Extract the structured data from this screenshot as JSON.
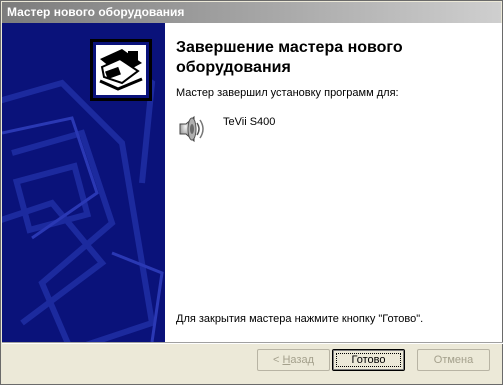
{
  "window": {
    "title": "Мастер нового оборудования"
  },
  "content": {
    "heading": "Завершение мастера нового оборудования",
    "subtext": "Мастер завершил установку программ для:",
    "device": {
      "name": "TeVii S400",
      "icon": "speaker-icon"
    },
    "footer": "Для закрытия мастера нажмите кнопку \"Готово\"."
  },
  "buttons": {
    "back_prefix": "< ",
    "back_accel": "Н",
    "back_rest": "азад",
    "finish": "Готово",
    "cancel": "Отмена"
  },
  "colors": {
    "side_panel": "#0a127a",
    "content_bg": "#ffffff",
    "titlebar": "#8c8c8c"
  }
}
